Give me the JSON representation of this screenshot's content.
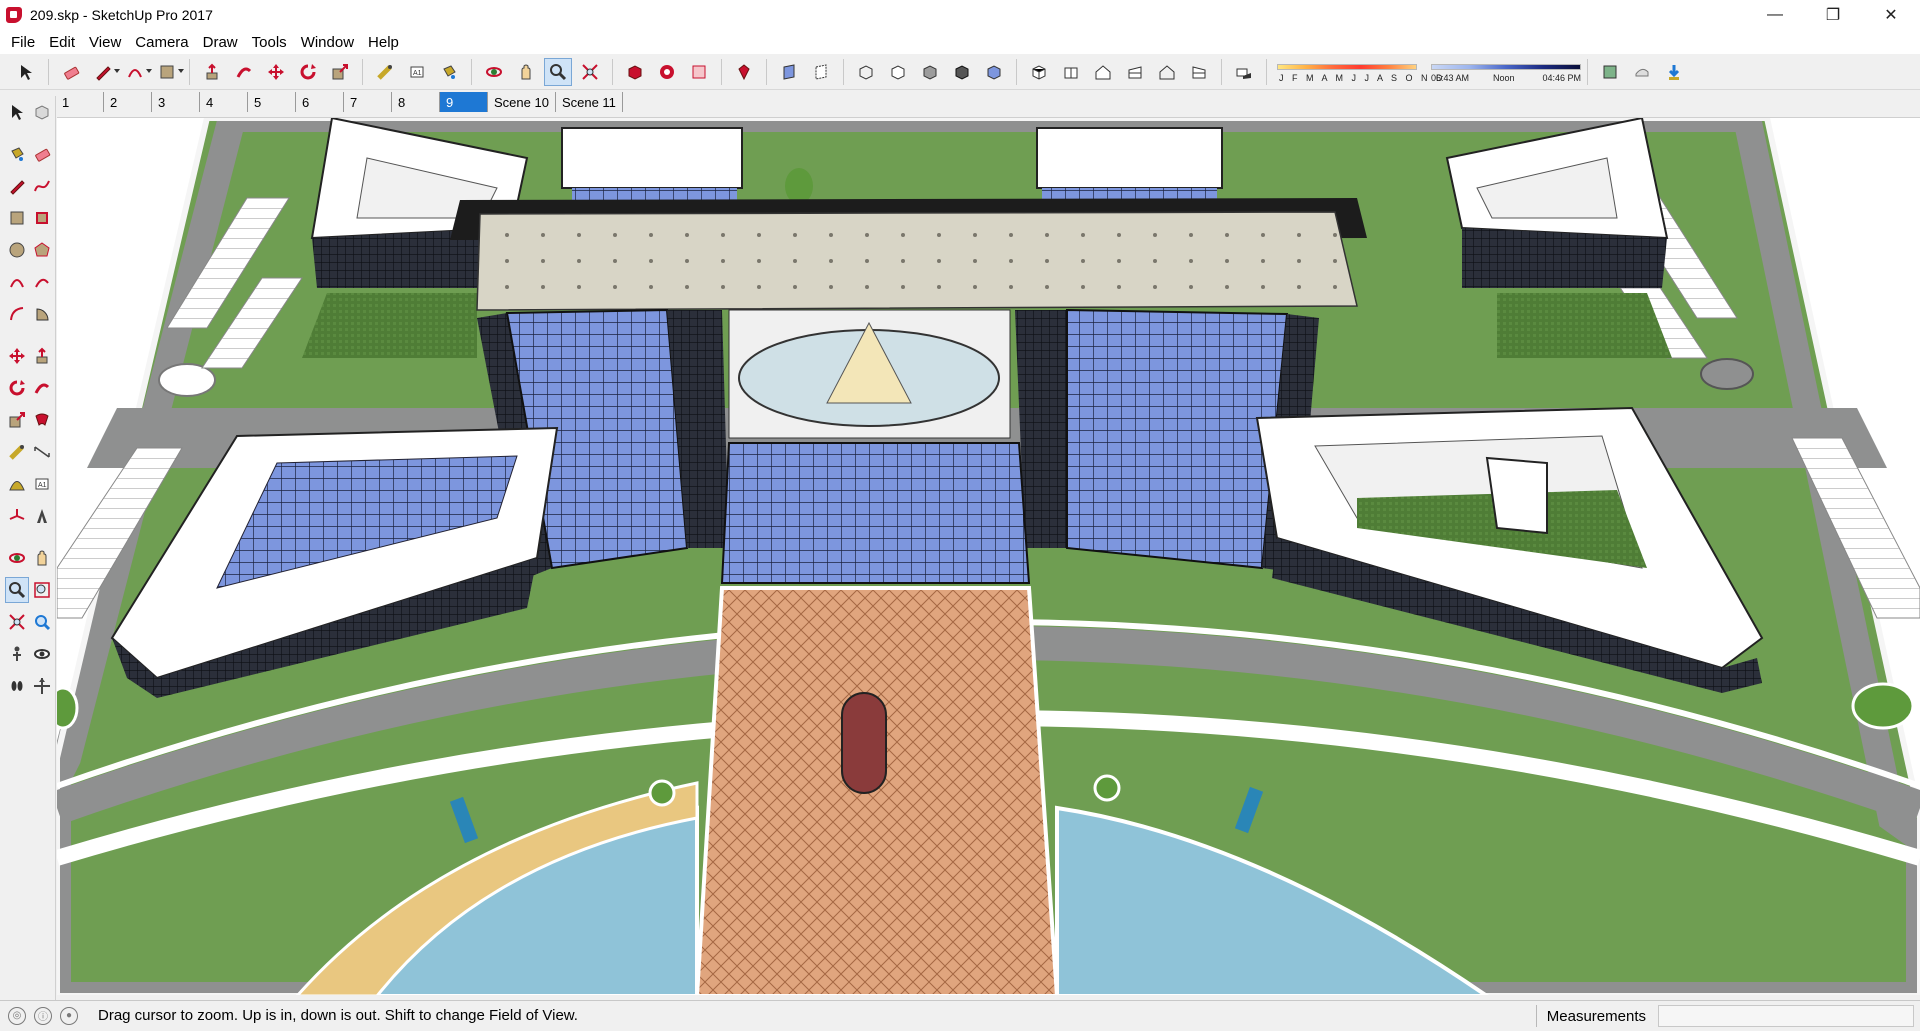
{
  "window": {
    "title": "209.skp - SketchUp Pro 2017",
    "controls": {
      "minimize": "—",
      "maximize": "❐",
      "close": "✕"
    }
  },
  "menu": [
    "File",
    "Edit",
    "View",
    "Camera",
    "Draw",
    "Tools",
    "Window",
    "Help"
  ],
  "toolbar": {
    "groups": [
      [
        "select-icon"
      ],
      [
        "eraser-icon",
        "pencil-icon",
        "arc-icon",
        "rectangle-icon"
      ],
      [
        "push-pull-icon",
        "follow-me-icon",
        "move-icon",
        "rotate-icon",
        "scale-icon"
      ],
      [
        "tape-measure-icon",
        "text-icon",
        "paint-bucket-icon"
      ],
      [
        "orbit-icon",
        "pan-icon",
        "zoom-icon",
        "zoom-extents-icon"
      ],
      [
        "warehouse-icon",
        "extension-warehouse-icon",
        "send-to-layout-icon"
      ],
      [
        "ruby-icon"
      ],
      [
        "xray-icon",
        "back-edges-icon"
      ],
      [
        "wireframe-icon",
        "hidden-line-icon",
        "shaded-icon",
        "shaded-with-textures-icon",
        "monochrome-icon"
      ],
      [
        "iso-view-icon",
        "top-view-icon",
        "front-view-icon",
        "right-view-icon",
        "back-view-icon",
        "left-view-icon"
      ],
      [
        "shadows-toggle-icon"
      ]
    ],
    "active": "zoom-icon",
    "shadow": {
      "months": "J F M A M J J A S O N D",
      "time_start": "06:43 AM",
      "time_mid": "Noon",
      "time_end": "04:46 PM"
    },
    "tail": [
      "model-info-icon",
      "components-icon",
      "download-icon"
    ]
  },
  "scenes": {
    "tabs": [
      "1",
      "2",
      "3",
      "4",
      "5",
      "6",
      "7",
      "8",
      "9",
      "Scene 10",
      "Scene 11"
    ],
    "active_index": 8
  },
  "left_tools": [
    [
      "select-icon",
      "make-component-icon"
    ],
    [
      "paint-bucket-icon",
      "eraser-icon"
    ],
    [
      "line-icon",
      "freehand-icon"
    ],
    [
      "rectangle-icon",
      "rotated-rectangle-icon"
    ],
    [
      "circle-icon",
      "polygon-icon"
    ],
    [
      "arc-icon",
      "two-point-arc-icon"
    ],
    [
      "three-point-arc-icon",
      "pie-icon"
    ],
    [
      "move-icon",
      "push-pull-icon"
    ],
    [
      "rotate-icon",
      "follow-me-icon"
    ],
    [
      "scale-icon",
      "offset-icon"
    ],
    [
      "tape-measure-icon",
      "dimension-icon"
    ],
    [
      "protractor-icon",
      "text-icon"
    ],
    [
      "axes-icon",
      "3d-text-icon"
    ],
    [
      "orbit-icon",
      "pan-icon"
    ],
    [
      "zoom-icon",
      "zoom-window-icon"
    ],
    [
      "zoom-extents-icon",
      "previous-view-icon"
    ],
    [
      "position-camera-icon",
      "look-around-icon"
    ],
    [
      "walk-icon",
      "section-plane-icon"
    ]
  ],
  "left_active": "zoom-icon",
  "status": {
    "message": "Drag cursor to zoom.  Up is in, down is out. Shift to change Field of View.",
    "measurements_label": "Measurements",
    "measurements_value": ""
  },
  "colors": {
    "grass": "#6f9e52",
    "road": "#8f9090",
    "glass": "#7c95dc",
    "canopy": "#d9d6c8",
    "water": "#8fc3d8",
    "plaza": "#e2a27a",
    "accent": "#1e78d4"
  }
}
